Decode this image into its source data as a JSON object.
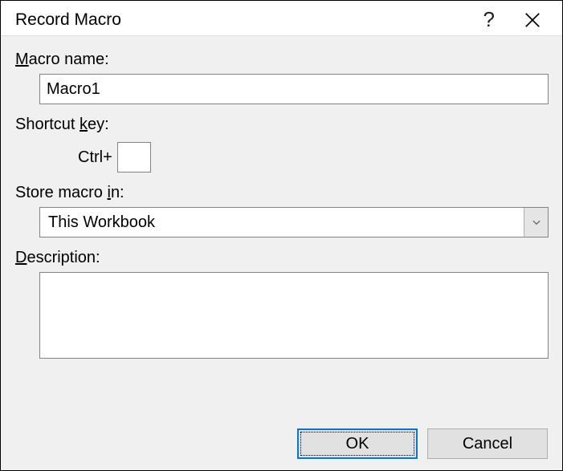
{
  "dialog": {
    "title": "Record Macro"
  },
  "labels": {
    "macro_name_pre": "M",
    "macro_name_post": "acro name:",
    "shortcut_pre": "Shortcut ",
    "shortcut_u": "k",
    "shortcut_post": "ey:",
    "ctrl": "Ctrl+",
    "store_pre": "Store macro ",
    "store_u": "i",
    "store_post": "n:",
    "desc_u": "D",
    "desc_post": "escription:"
  },
  "values": {
    "macro_name": "Macro1",
    "shortcut_key": "",
    "store_in": "This Workbook",
    "description": ""
  },
  "buttons": {
    "ok": "OK",
    "cancel": "Cancel"
  }
}
